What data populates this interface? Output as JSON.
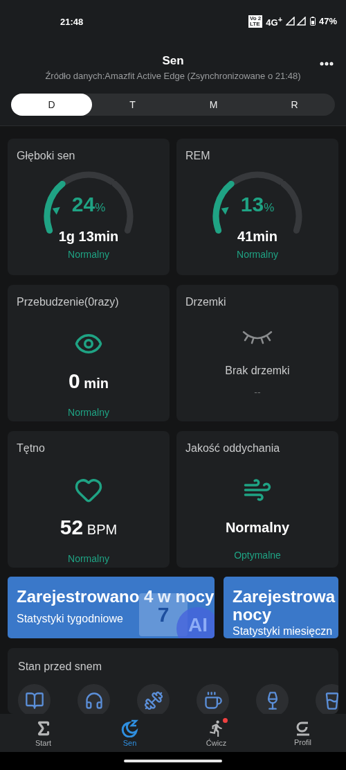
{
  "status_bar": {
    "time": "21:48",
    "volte_top": "Vo",
    "volte_sub": "2",
    "volte_bottom": "LTE",
    "network": "4G$^{+}$",
    "battery": "47%"
  },
  "header": {
    "title": "Sen",
    "subtitle": "Źródło danych:Amazfit Active Edge (Zsynchronizowane o 21:48)"
  },
  "tabs": [
    {
      "label": "D",
      "selected": true
    },
    {
      "label": "T",
      "selected": false
    },
    {
      "label": "M",
      "selected": false
    },
    {
      "label": "R",
      "selected": false
    }
  ],
  "cards": [
    {
      "kind": "gauge",
      "title": "Głęboki sen",
      "percent": "24",
      "percent_unit": "%",
      "value": "1g 13min",
      "status": "Normalny",
      "active": true
    },
    {
      "kind": "gauge",
      "title": "REM",
      "percent": "13",
      "percent_unit": "%",
      "value": "41min",
      "status": "Normalny",
      "active": true
    },
    {
      "kind": "eye",
      "title": "Przebudzenie(0razy)",
      "value": "0",
      "unit": "min",
      "status": "Normalny",
      "active": true
    },
    {
      "kind": "closed-eye",
      "title": "Drzemki",
      "value": "Brak drzemki",
      "status": "--",
      "active": false
    },
    {
      "kind": "heart",
      "title": "Tętno",
      "value": "52",
      "unit": "BPM",
      "status": "Normalny",
      "active": true
    },
    {
      "kind": "wind",
      "title": "Jakość oddychania",
      "value": "Normalny",
      "status": "Optymalne",
      "active": true
    }
  ],
  "banners": [
    {
      "title": "Zarejestrowano 4 w nocy",
      "subtitle": "Statystyki tygodniowe",
      "calendar_day": "7",
      "ai_label": "AI"
    },
    {
      "title": "Zarejestrowa nocy",
      "subtitle": "Statystyki miesięczn"
    }
  ],
  "pre_sleep": {
    "title": "Stan przed snem",
    "items": [
      {
        "kind": "book"
      },
      {
        "kind": "headphones"
      },
      {
        "kind": "dumbbell"
      },
      {
        "kind": "coffee"
      },
      {
        "kind": "wine"
      },
      {
        "kind": "glass"
      }
    ]
  },
  "nav": [
    {
      "kind": "sigma",
      "label": "Start",
      "selected": false,
      "badge": false
    },
    {
      "kind": "moon",
      "label": "Sen",
      "selected": true,
      "badge": false
    },
    {
      "kind": "runner",
      "label": "Ćwicz",
      "selected": false,
      "badge": true
    },
    {
      "kind": "profile",
      "label": "Profil",
      "selected": false,
      "badge": false
    }
  ]
}
